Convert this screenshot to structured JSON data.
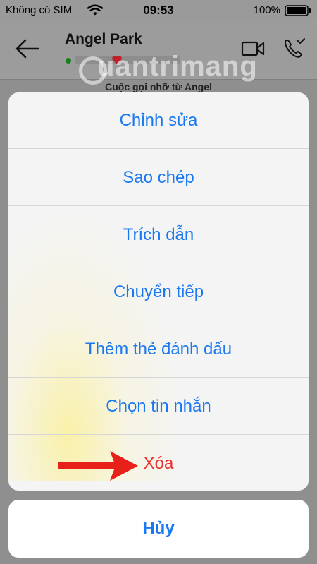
{
  "status_bar": {
    "carrier": "Không có SIM",
    "time": "09:53",
    "battery": "100%"
  },
  "chat_header": {
    "contact_name": "Angel Park",
    "watermark": "uantrimang",
    "preview": "Cuộc gọi nhỡ từ Angel"
  },
  "action_sheet": {
    "items": [
      {
        "label": "Chỉnh sửa"
      },
      {
        "label": "Sao chép"
      },
      {
        "label": "Trích dẫn"
      },
      {
        "label": "Chuyển tiếp"
      },
      {
        "label": "Thêm thẻ đánh dấu"
      },
      {
        "label": "Chọn tin nhắn"
      },
      {
        "label": "Xóa"
      }
    ],
    "cancel_label": "Hủy"
  },
  "colors": {
    "action_blue": "#1a78f0",
    "destructive_red": "#ec2e2e",
    "annotation_arrow": "#e8201a"
  },
  "icons": [
    "back-arrow-icon",
    "video-call-icon",
    "phone-missed-icon",
    "wifi-icon",
    "battery-icon",
    "heart-icon"
  ]
}
